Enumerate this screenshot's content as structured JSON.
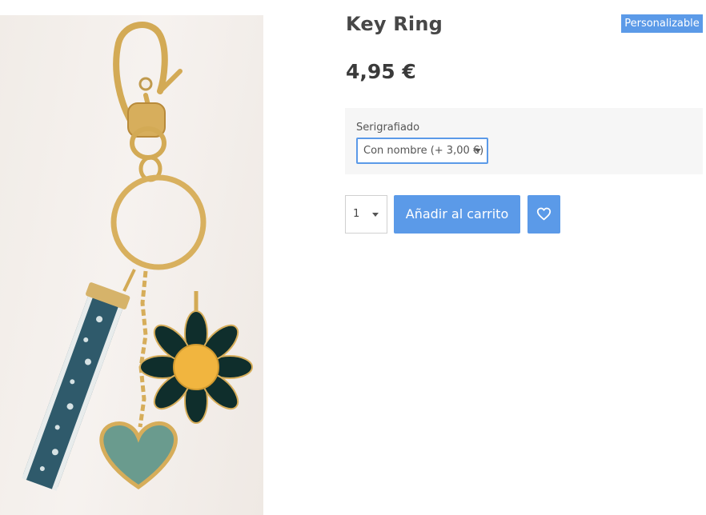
{
  "product": {
    "title": "Key Ring",
    "badge": "Personalizable",
    "price": "4,95 €",
    "image_alt": "keyring-with-flower-heart-and-ribbon-charms"
  },
  "variants": {
    "label": "Serigrafiado",
    "selected": "Con nombre (+ 3,00 €)"
  },
  "purchase": {
    "quantity": "1",
    "add_to_cart_label": "Añadir al carrito",
    "wishlist_icon": "heart-icon"
  },
  "colors": {
    "accent": "#5b9ae8",
    "text": "#414141",
    "panel": "#f6f6f6"
  }
}
